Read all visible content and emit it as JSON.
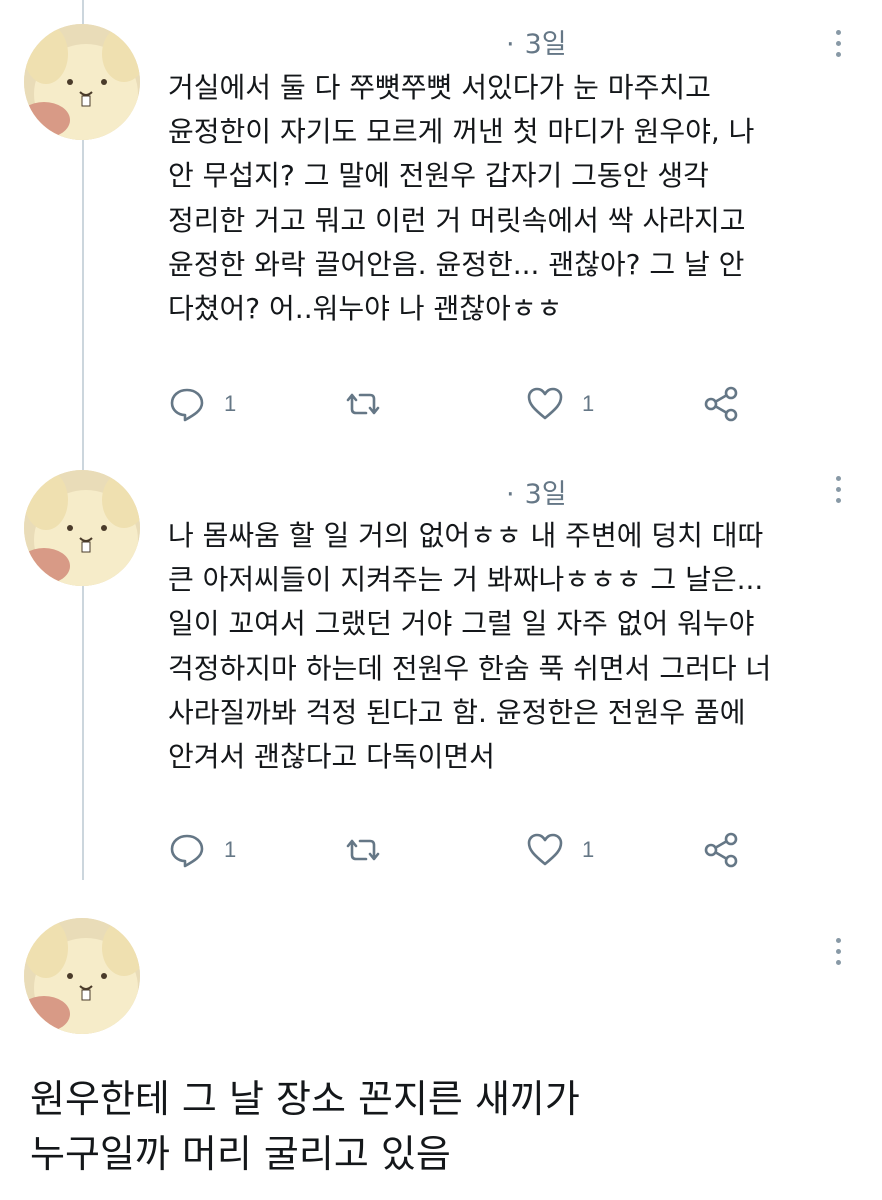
{
  "tweets": [
    {
      "time": "3일",
      "lines": [
        "거실에서 둘 다 쭈뼛쭈뼛 서있다가 눈 마주치고",
        "윤정한이 자기도 모르게 꺼낸 첫 마디가 원우야, 나",
        "안 무섭지? 그 말에 전원우 갑자기 그동안 생각",
        "정리한 거고 뭐고 이런 거 머릿속에서 싹 사라지고",
        "윤정한 와락 끌어안음. 윤정한... 괜찮아? 그 날 안",
        "다쳤어? 어..워누야 나 괜찮아ㅎㅎ"
      ],
      "reply_count": "1",
      "like_count": "1"
    },
    {
      "time": "3일",
      "lines": [
        "나 몸싸움 할 일 거의 없어ㅎㅎ 내 주변에 덩치 대따",
        "큰 아저씨들이 지켜주는 거 봐짜나ㅎㅎㅎ 그 날은...",
        "일이 꼬여서 그랬던 거야 그럴 일 자주 없어 워누야",
        "걱정하지마 하는데 전원우 한숨 푹 쉬면서 그러다 너",
        "사라질까봐 걱정 된다고 함. 윤정한은 전원우 품에",
        "안겨서 괜찮다고 다독이면서"
      ],
      "reply_count": "1",
      "like_count": "1"
    },
    {
      "lines": [
        "원우한테 그 날 장소 꼰지른 새끼가",
        "누구일까 머리 굴리고 있음"
      ]
    }
  ],
  "icons": {
    "reply": "reply-icon",
    "retweet": "retweet-icon",
    "like": "heart-icon",
    "share": "share-icon",
    "more": "more-vertical-icon"
  },
  "colors": {
    "text": "#14171a",
    "muted": "#657786",
    "thread_line": "#ccd6dd"
  }
}
